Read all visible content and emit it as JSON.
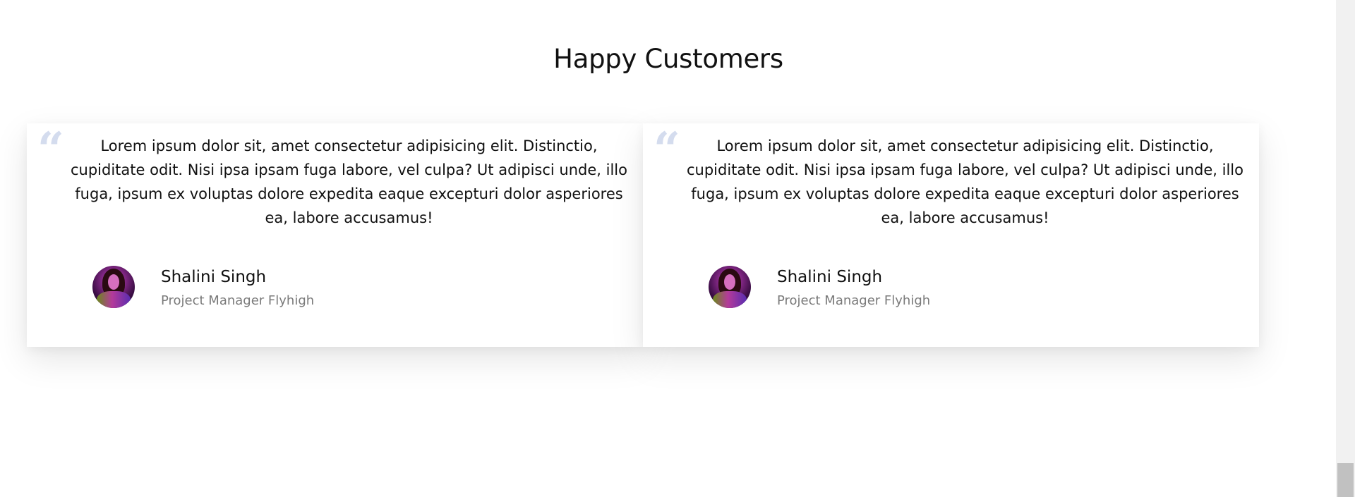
{
  "section": {
    "title": "Happy Customers"
  },
  "testimonials": [
    {
      "quote_icon": "quote-icon",
      "quote_symbol": "“",
      "text": "Lorem ipsum dolor sit, amet consectetur adipisicing elit. Distinctio, cupiditate odit. Nisi ipsa ipsam fuga labore, vel culpa? Ut adipisci unde, illo fuga, ipsum ex voluptas dolore expedita eaque excepturi dolor asperiores ea, labore accusamus!",
      "author_name": "Shalini Singh",
      "author_role": "Project Manager Flyhigh"
    },
    {
      "quote_icon": "quote-icon",
      "quote_symbol": "“",
      "text": "Lorem ipsum dolor sit, amet consectetur adipisicing elit. Distinctio, cupiditate odit. Nisi ipsa ipsam fuga labore, vel culpa? Ut adipisci unde, illo fuga, ipsum ex voluptas dolore expedita eaque excepturi dolor asperiores ea, labore accusamus!",
      "author_name": "Shalini Singh",
      "author_role": "Project Manager Flyhigh"
    }
  ],
  "colors": {
    "quote_mark": "#d4dcee",
    "role_text": "#7a7a7a",
    "card_background": "#ffffff"
  }
}
